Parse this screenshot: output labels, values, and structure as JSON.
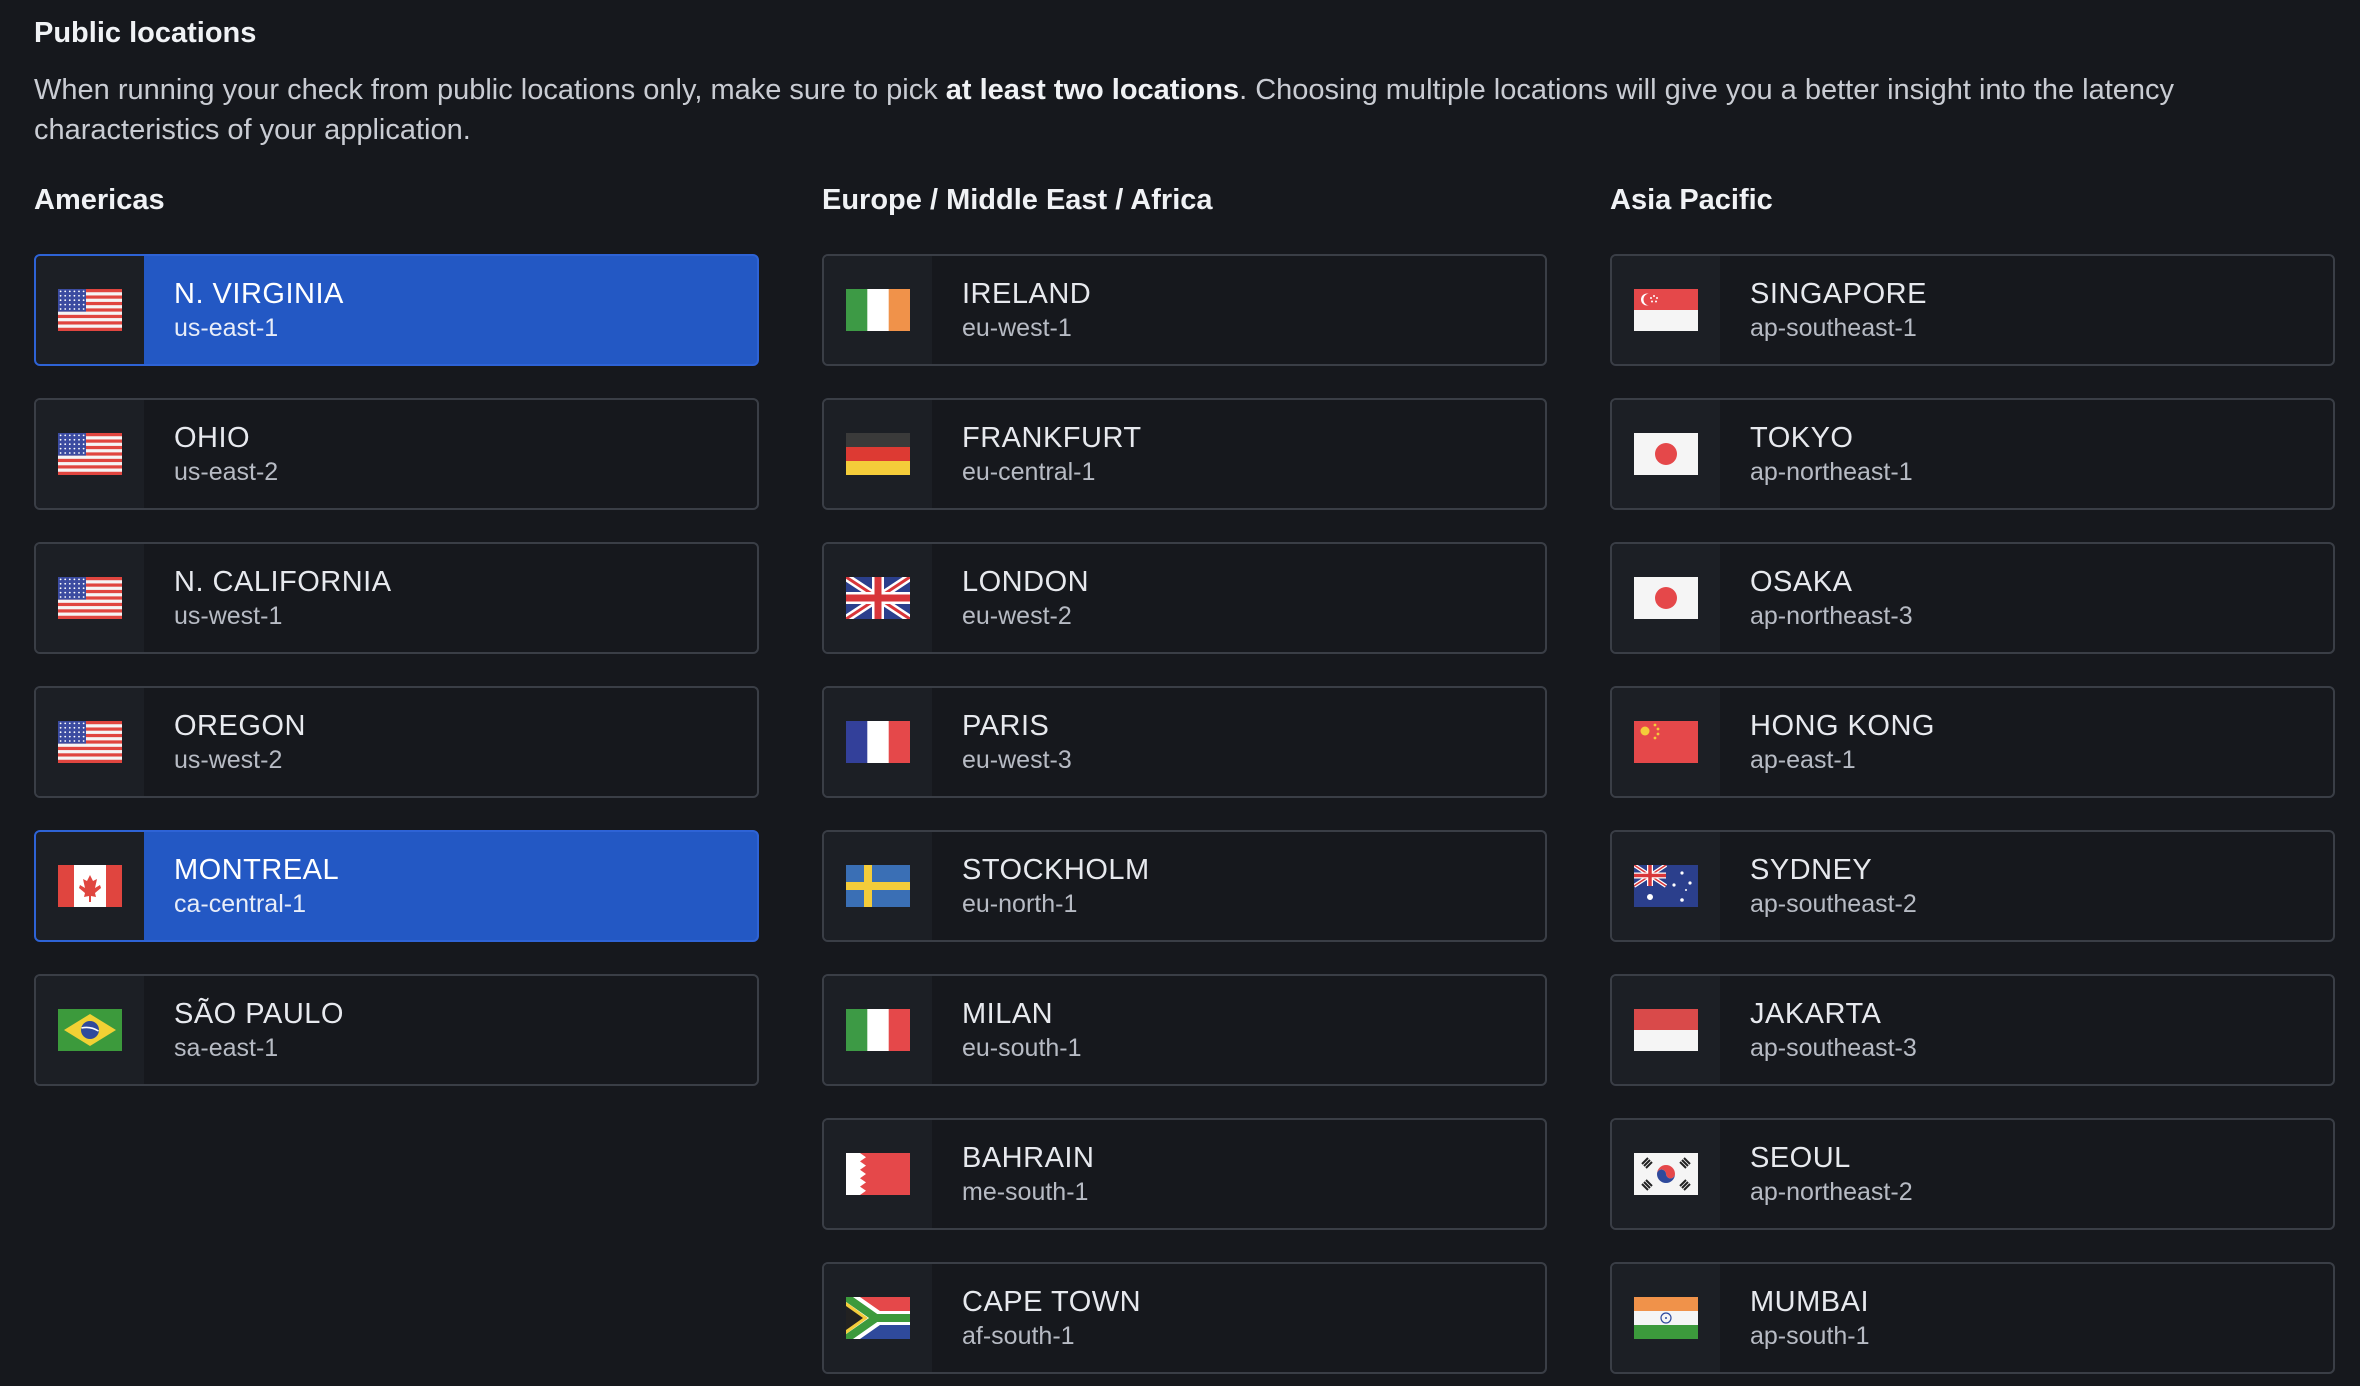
{
  "title": "Public locations",
  "description": {
    "before": "When running your check from public locations only, make sure to pick ",
    "bold": "at least two locations",
    "after": ". Choosing multiple locations will give you a better insight into the latency characteristics of your application."
  },
  "colors": {
    "background": "#16181d",
    "selected": "#2358c4",
    "border": "#3a3e46"
  },
  "columns": [
    {
      "title": "Americas",
      "items": [
        {
          "city": "N. VIRGINIA",
          "region": "us-east-1",
          "flag": "us-flag-icon",
          "selected": true
        },
        {
          "city": "OHIO",
          "region": "us-east-2",
          "flag": "us-flag-icon",
          "selected": false
        },
        {
          "city": "N. CALIFORNIA",
          "region": "us-west-1",
          "flag": "us-flag-icon",
          "selected": false
        },
        {
          "city": "OREGON",
          "region": "us-west-2",
          "flag": "us-flag-icon",
          "selected": false
        },
        {
          "city": "MONTREAL",
          "region": "ca-central-1",
          "flag": "canada-flag-icon",
          "selected": true
        },
        {
          "city": "SÃO PAULO",
          "region": "sa-east-1",
          "flag": "brazil-flag-icon",
          "selected": false
        }
      ]
    },
    {
      "title": "Europe / Middle East / Africa",
      "items": [
        {
          "city": "IRELAND",
          "region": "eu-west-1",
          "flag": "ireland-flag-icon",
          "selected": false
        },
        {
          "city": "FRANKFURT",
          "region": "eu-central-1",
          "flag": "germany-flag-icon",
          "selected": false
        },
        {
          "city": "LONDON",
          "region": "eu-west-2",
          "flag": "uk-flag-icon",
          "selected": false
        },
        {
          "city": "PARIS",
          "region": "eu-west-3",
          "flag": "france-flag-icon",
          "selected": false
        },
        {
          "city": "STOCKHOLM",
          "region": "eu-north-1",
          "flag": "sweden-flag-icon",
          "selected": false
        },
        {
          "city": "MILAN",
          "region": "eu-south-1",
          "flag": "italy-flag-icon",
          "selected": false
        },
        {
          "city": "BAHRAIN",
          "region": "me-south-1",
          "flag": "bahrain-flag-icon",
          "selected": false
        },
        {
          "city": "CAPE TOWN",
          "region": "af-south-1",
          "flag": "south-africa-flag-icon",
          "selected": false
        }
      ]
    },
    {
      "title": "Asia Pacific",
      "items": [
        {
          "city": "SINGAPORE",
          "region": "ap-southeast-1",
          "flag": "singapore-flag-icon",
          "selected": false
        },
        {
          "city": "TOKYO",
          "region": "ap-northeast-1",
          "flag": "japan-flag-icon",
          "selected": false
        },
        {
          "city": "OSAKA",
          "region": "ap-northeast-3",
          "flag": "japan-flag-icon",
          "selected": false
        },
        {
          "city": "HONG KONG",
          "region": "ap-east-1",
          "flag": "china-flag-icon",
          "selected": false
        },
        {
          "city": "SYDNEY",
          "region": "ap-southeast-2",
          "flag": "australia-flag-icon",
          "selected": false
        },
        {
          "city": "JAKARTA",
          "region": "ap-southeast-3",
          "flag": "indonesia-flag-icon",
          "selected": false
        },
        {
          "city": "SEOUL",
          "region": "ap-northeast-2",
          "flag": "south-korea-flag-icon",
          "selected": false
        },
        {
          "city": "MUMBAI",
          "region": "ap-south-1",
          "flag": "india-flag-icon",
          "selected": false
        }
      ]
    }
  ]
}
